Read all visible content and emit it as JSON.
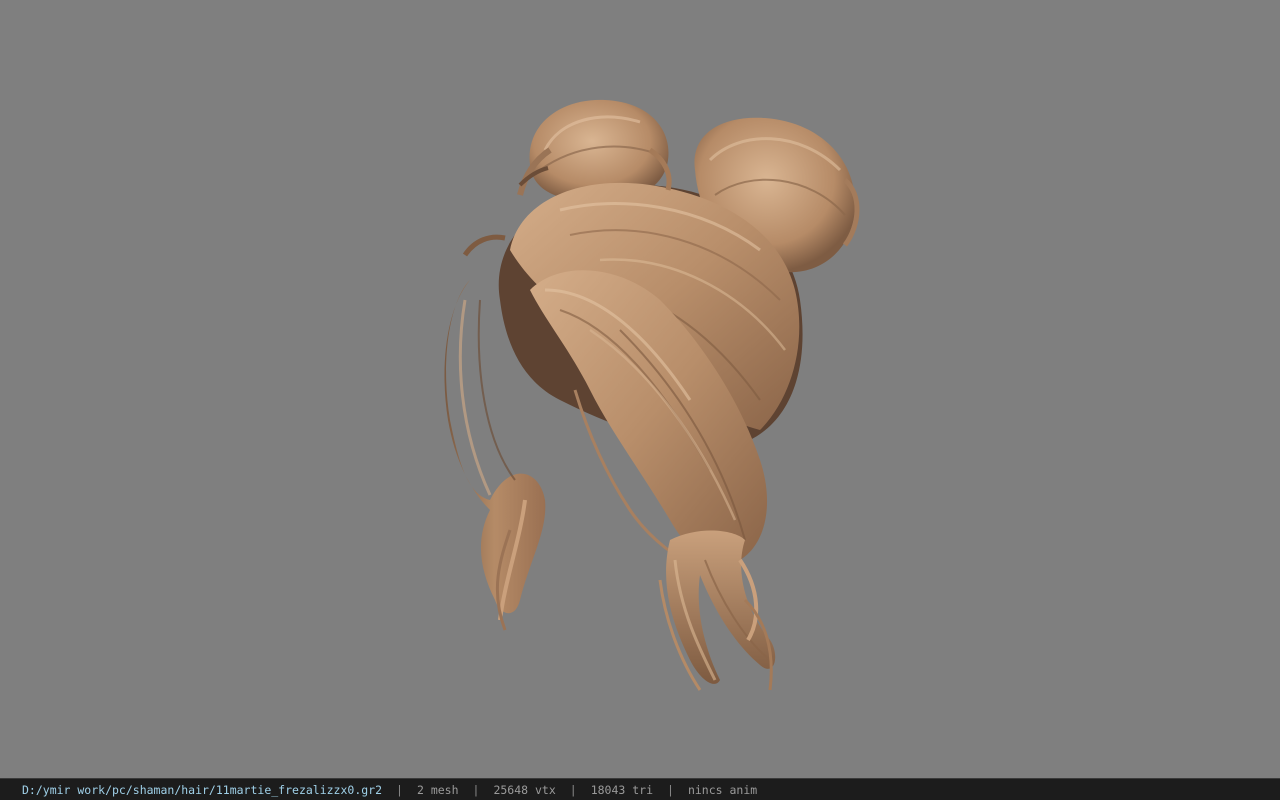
{
  "viewport": {
    "background_color": "#7f7f7f",
    "model": {
      "subject": "hair-model",
      "hair_color_light": "#caa27e",
      "hair_color_mid": "#a47a58",
      "hair_color_dark": "#5e4332"
    }
  },
  "statusbar": {
    "file_path": "D:/ymir work/pc/shaman/hair/11martie_frezalizzx0.gr2",
    "separator": "|",
    "mesh_count": "2 mesh",
    "vertex_count": "25648 vtx",
    "triangle_count": "18043 tri",
    "anim_status": "nincs anim",
    "path_color": "#9fd0e8",
    "background_color": "#1c1c1c"
  }
}
